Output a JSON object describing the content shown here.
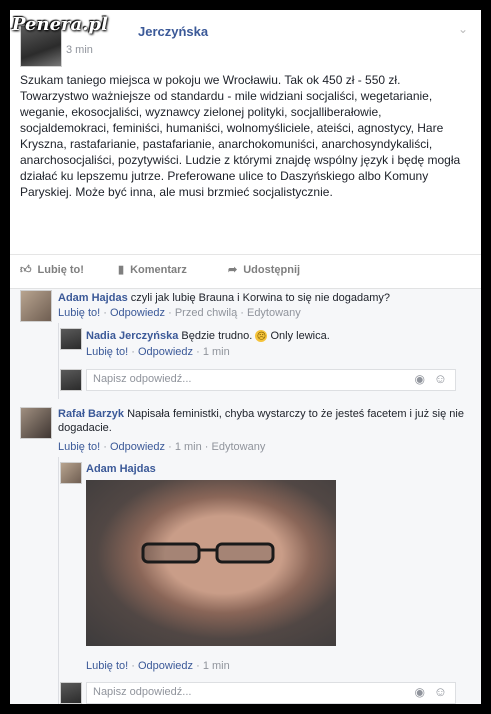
{
  "watermark": "Penera.pl",
  "post": {
    "author": "Jerczyńska",
    "time": "3 min",
    "text": "Szukam taniego miejsca w pokoju we Wrocławiu. Tak ok 450 zł - 550 zł. Towarzystwo ważniejsze od standardu - mile widziani socjaliści, wegetarianie, weganie, ekosocjaliści, wyznawcy zielonej polityki, socjalliberałowie, socjaldemokraci, feminiści, humaniści, wolnomyśliciele, ateiści, agnostycy, Hare Kryszna, rastafarianie, pastafarianie, anarchokomuniści, anarchosyndykaliści, anarchosocjaliści, pozytywiści. Ludzie z którymi znajdę wspólny język i będę mogła działać ku lepszemu jutrze. Preferowane ulice to Daszyńskiego albo Komuny Paryskiej. Może być inna, ale musi brzmieć socjalistycznie."
  },
  "actions": {
    "like": "Lubię to!",
    "comment": "Komentarz",
    "share": "Udostępnij"
  },
  "comments": [
    {
      "name": "Adam Hajdas",
      "text": "czyli jak lubię Brauna i Korwina to się nie dogadamy?",
      "like": "Lubię to!",
      "reply": "Odpowiedz",
      "meta": "Przed chwilą · Edytowany"
    },
    {
      "name": "Nadia Jerczyńska",
      "text": "Będzie trudno.",
      "text2": "Only lewica.",
      "like": "Lubię to!",
      "reply": "Odpowiedz",
      "meta": "1 min"
    },
    {
      "name": "Rafał Barzyk",
      "text": "Napisała feministki, chyba wystarczy to że jesteś facetem i już się nie dogadacie.",
      "like": "Lubię to!",
      "reply": "Odpowiedz",
      "meta": "1 min · Edytowany"
    },
    {
      "name": "Adam Hajdas",
      "like": "Lubię to!",
      "reply": "Odpowiedz",
      "meta": "1 min"
    }
  ],
  "reply_placeholder": "Napisz odpowiedź...",
  "separator": "·"
}
